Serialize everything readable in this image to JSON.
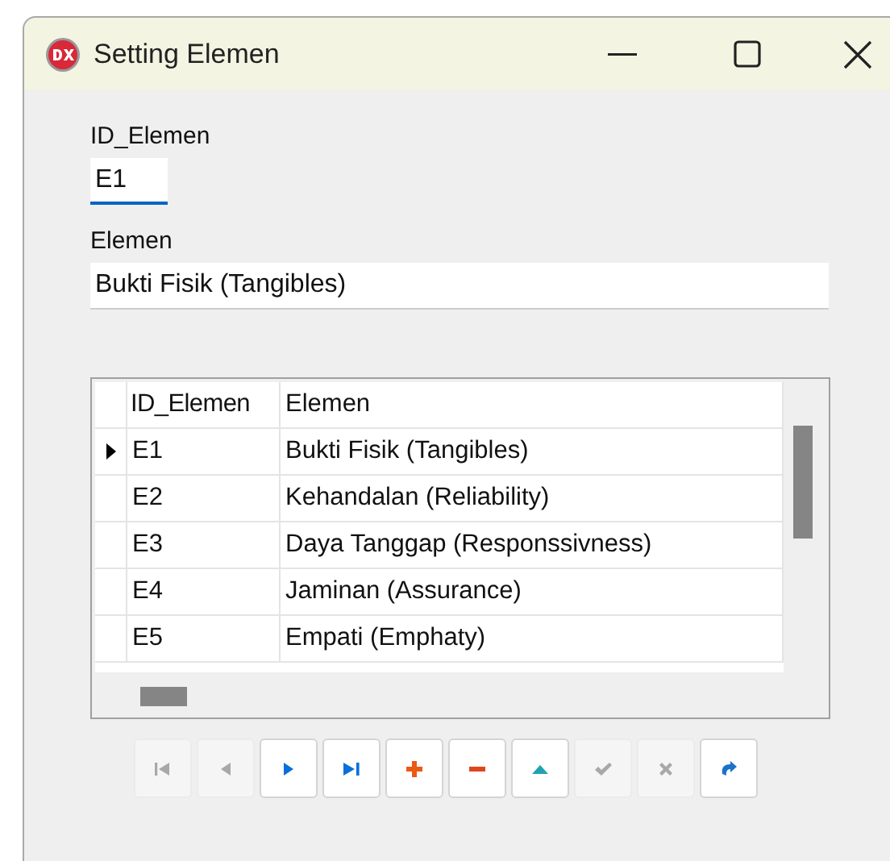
{
  "window": {
    "title": "Setting Elemen"
  },
  "fields": [
    {
      "label": "ID_Elemen",
      "value": "E1",
      "focused": true,
      "kind": "short"
    },
    {
      "label": "Elemen",
      "value": "Bukti Fisik (Tangibles)",
      "focused": false,
      "kind": "wide"
    }
  ],
  "table": {
    "columns": [
      "ID_Elemen",
      "Elemen"
    ],
    "rows": [
      {
        "cells": [
          "E1",
          "Bukti Fisik (Tangibles)"
        ],
        "selected": true
      },
      {
        "cells": [
          "E2",
          "Kehandalan (Reliability)"
        ],
        "selected": false
      },
      {
        "cells": [
          "E3",
          "Daya Tanggap (Responssivness)"
        ],
        "selected": false
      },
      {
        "cells": [
          "E4",
          "Jaminan (Assurance)"
        ],
        "selected": false
      },
      {
        "cells": [
          "E5",
          "Empati (Emphaty)"
        ],
        "selected": false
      }
    ]
  },
  "navigator": [
    {
      "kind": "first",
      "disabled": true
    },
    {
      "kind": "prior",
      "disabled": true
    },
    {
      "kind": "next",
      "disabled": false
    },
    {
      "kind": "last",
      "disabled": false
    },
    {
      "kind": "insert",
      "disabled": false
    },
    {
      "kind": "delete",
      "disabled": false
    },
    {
      "kind": "edit",
      "disabled": false
    },
    {
      "kind": "post",
      "disabled": true
    },
    {
      "kind": "cancel",
      "disabled": true
    },
    {
      "kind": "refresh",
      "disabled": false
    }
  ]
}
